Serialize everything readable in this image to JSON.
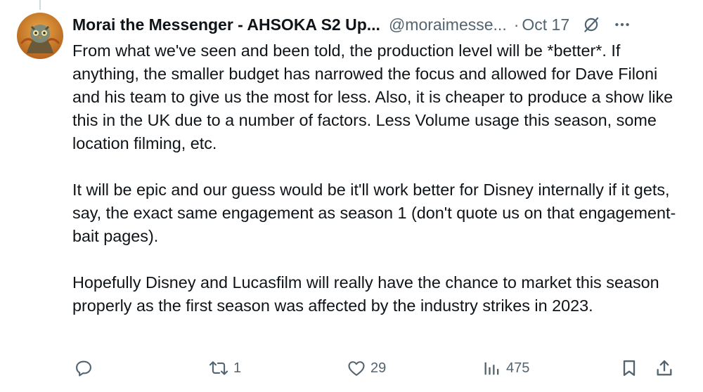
{
  "tweet": {
    "author": {
      "display_name": "Morai the Messenger - AHSOKA S2 Up...",
      "handle": "@moraimesse...",
      "avatar_icon": "owl-avatar-icon"
    },
    "separator": "·",
    "date": "Oct 17",
    "paragraphs": [
      "From what we've seen and been told, the production level will be *better*. If anything, the smaller budget has narrowed the focus and allowed for Dave Filoni and his team to give us the most for less. Also, it is cheaper to produce a show like this in the UK due to a number of factors. Less Volume usage this season, some location filming, etc.",
      "It will be epic and our guess would be it'll work better for Disney internally if it gets, say, the exact same engagement as season 1 (don't quote us on that engagement-bait pages).",
      "Hopefully Disney and Lucasfilm will really have the chance to market this season properly as the first season was affected by the industry strikes in 2023."
    ],
    "actions": {
      "reply_count": "",
      "retweet_count": "1",
      "like_count": "29",
      "views_count": "475"
    }
  },
  "colors": {
    "text_primary": "#0f1419",
    "text_secondary": "#536471",
    "thread_line": "#cfd9de"
  },
  "icons": [
    "grok-icon",
    "more-icon",
    "reply-icon",
    "retweet-icon",
    "like-icon",
    "views-icon",
    "bookmark-icon",
    "share-icon"
  ]
}
